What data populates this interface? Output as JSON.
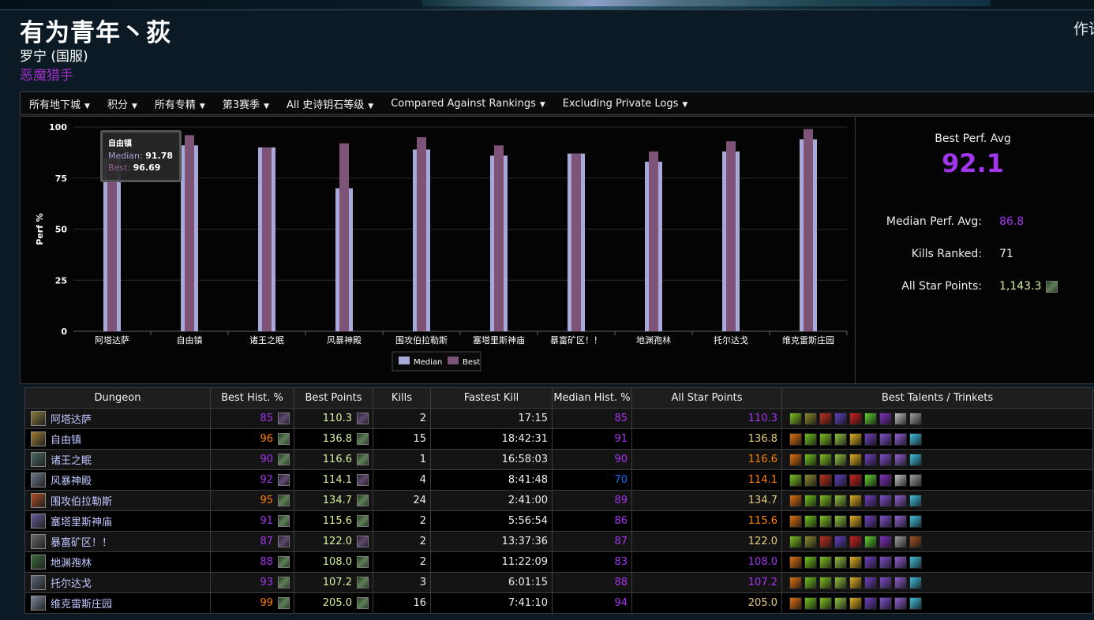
{
  "header": {
    "character_name": "有为青年丶荻",
    "realm": "罗宁 (国服)",
    "class_name": "恶魔猎手",
    "right_cut_text": "作语"
  },
  "filters": [
    {
      "label": "所有地下城"
    },
    {
      "label": "积分"
    },
    {
      "label": "所有专精"
    },
    {
      "label": "第3赛季"
    },
    {
      "label": "All 史诗钥石等级"
    },
    {
      "label": "Compared Against Rankings"
    },
    {
      "label": "Excluding Private Logs"
    }
  ],
  "chart_data": {
    "type": "bar",
    "ylabel": "Perf %",
    "ylim": [
      0,
      100
    ],
    "yticks": [
      0,
      25,
      50,
      75,
      100
    ],
    "categories": [
      "阿塔达萨",
      "自由镇",
      "诸王之眠",
      "风暴神殿",
      "围攻伯拉勒斯",
      "塞塔里斯神庙",
      "暴富矿区！！",
      "地渊孢林",
      "托尔达戈",
      "维克雷斯庄园"
    ],
    "series": [
      {
        "name": "Median",
        "color": "#a7a9d8",
        "values": [
          85,
          91,
          90,
          70,
          89,
          86,
          87,
          83,
          88,
          94
        ]
      },
      {
        "name": "Best",
        "color": "#7d5478",
        "values": [
          85,
          96,
          90,
          92,
          95,
          91,
          87,
          88,
          93,
          99
        ]
      }
    ],
    "legend_position": "bottom-center",
    "grid": true,
    "tooltip": {
      "title": "自由镇",
      "median_label": "Median:",
      "median_value": "91.78",
      "best_label": "Best:",
      "best_value": "96.69"
    }
  },
  "stats": {
    "best_perf_avg_label": "Best Perf. Avg",
    "best_perf_avg": "92.1",
    "median_perf_avg_label": "Median Perf. Avg:",
    "median_perf_avg": "86.8",
    "kills_ranked_label": "Kills Ranked:",
    "kills_ranked": "71",
    "all_star_label": "All Star Points:",
    "all_star_value": "1,143.3"
  },
  "table": {
    "headers": [
      "Dungeon",
      "Best Hist. %",
      "Best Points",
      "Kills",
      "Fastest Kill",
      "Median Hist. %",
      "All Star Points",
      "Best Talents / Trinkets"
    ],
    "rows": [
      {
        "dungeon": "阿塔达萨",
        "icon": "#8a7a3a",
        "best_hist": "85",
        "best_hist_color": "epic",
        "best_points": "110.3",
        "points_icon": "p",
        "kills": "2",
        "fastest": "17:15",
        "median_hist": "85",
        "median_color": "epic",
        "allstar": "110.3",
        "allstar_color": "epic",
        "talents": "A"
      },
      {
        "dungeon": "自由镇",
        "icon": "#a07a30",
        "best_hist": "96",
        "best_hist_color": "legend",
        "best_points": "136.8",
        "points_icon": "g",
        "kills": "15",
        "fastest": "18:42:31",
        "median_hist": "91",
        "median_color": "epic",
        "allstar": "136.8",
        "allstar_color": "gold",
        "talents": "B"
      },
      {
        "dungeon": "诸王之眠",
        "icon": "#4a6a68",
        "best_hist": "90",
        "best_hist_color": "epic",
        "best_points": "116.6",
        "points_icon": "g",
        "kills": "1",
        "fastest": "16:58:03",
        "median_hist": "90",
        "median_color": "epic",
        "allstar": "116.6",
        "allstar_color": "legend",
        "talents": "B"
      },
      {
        "dungeon": "风暴神殿",
        "icon": "#6a7a8a",
        "best_hist": "92",
        "best_hist_color": "epic",
        "best_points": "114.1",
        "points_icon": "p",
        "kills": "4",
        "fastest": "8:41:48",
        "median_hist": "70",
        "median_color": "rare",
        "allstar": "114.1",
        "allstar_color": "legend",
        "talents": "A"
      },
      {
        "dungeon": "围攻伯拉勒斯",
        "icon": "#b04a20",
        "best_hist": "95",
        "best_hist_color": "legend",
        "best_points": "134.7",
        "points_icon": "g",
        "kills": "24",
        "fastest": "2:41:00",
        "median_hist": "89",
        "median_color": "epic",
        "allstar": "134.7",
        "allstar_color": "gold",
        "talents": "B"
      },
      {
        "dungeon": "塞塔里斯神庙",
        "icon": "#6a5a9a",
        "best_hist": "91",
        "best_hist_color": "epic",
        "best_points": "115.6",
        "points_icon": "g",
        "kills": "2",
        "fastest": "5:56:54",
        "median_hist": "86",
        "median_color": "epic",
        "allstar": "115.6",
        "allstar_color": "legend",
        "talents": "B"
      },
      {
        "dungeon": "暴富矿区！！",
        "icon": "#6a6a6a",
        "best_hist": "87",
        "best_hist_color": "epic",
        "best_points": "122.0",
        "points_icon": "p",
        "kills": "2",
        "fastest": "13:37:36",
        "median_hist": "87",
        "median_color": "epic",
        "allstar": "122.0",
        "allstar_color": "gold",
        "talents": "C"
      },
      {
        "dungeon": "地渊孢林",
        "icon": "#3a6a3a",
        "best_hist": "88",
        "best_hist_color": "epic",
        "best_points": "108.0",
        "points_icon": "g",
        "kills": "2",
        "fastest": "11:22:09",
        "median_hist": "83",
        "median_color": "epic",
        "allstar": "108.0",
        "allstar_color": "epic",
        "talents": "B"
      },
      {
        "dungeon": "托尔达戈",
        "icon": "#5a6a7a",
        "best_hist": "93",
        "best_hist_color": "epic",
        "best_points": "107.2",
        "points_icon": "g",
        "kills": "3",
        "fastest": "6:01:15",
        "median_hist": "88",
        "median_color": "epic",
        "allstar": "107.2",
        "allstar_color": "epic",
        "talents": "B"
      },
      {
        "dungeon": "维克雷斯庄园",
        "icon": "#7a8a9a",
        "best_hist": "99",
        "best_hist_color": "legend",
        "best_points": "205.0",
        "points_icon": "g",
        "kills": "16",
        "fastest": "7:41:10",
        "median_hist": "94",
        "median_color": "epic",
        "allstar": "205.0",
        "allstar_color": "gold",
        "talents": "B"
      }
    ],
    "talent_sets": {
      "A": [
        "#7cc020",
        "#8a8a30",
        "#c03020",
        "#6040c0",
        "#d02020",
        "#60d030",
        "#8030c0",
        "#c0c0c0",
        "#a0a0a0"
      ],
      "B": [
        "#e07010",
        "#70c020",
        "#80c020",
        "#90c040",
        "#e0b020",
        "#7040c0",
        "#8050d0",
        "#9060d0",
        "#40c0e0"
      ],
      "C": [
        "#7cc020",
        "#8a8a30",
        "#c03020",
        "#6040c0",
        "#d02020",
        "#60d030",
        "#8030c0",
        "#a0a0a0",
        "#a05020"
      ]
    }
  }
}
